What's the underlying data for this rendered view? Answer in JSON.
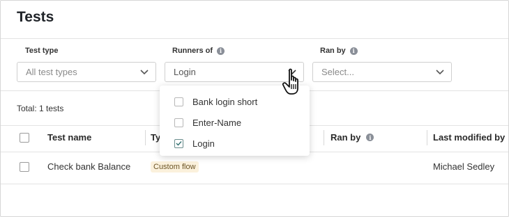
{
  "page": {
    "title": "Tests"
  },
  "filters": {
    "test_type": {
      "label": "Test type",
      "placeholder": "All test types"
    },
    "runners_of": {
      "label": "Runners of",
      "value": "Login"
    },
    "ran_by": {
      "label": "Ran by",
      "placeholder": "Select..."
    }
  },
  "dropdown": {
    "options": [
      {
        "label": "Bank login short",
        "checked": false
      },
      {
        "label": "Enter-Name",
        "checked": false
      },
      {
        "label": "Login",
        "checked": true
      }
    ]
  },
  "summary": {
    "total": "Total: 1 tests"
  },
  "table": {
    "columns": [
      "Test name",
      "Ty",
      "Ran by",
      "Last modified by"
    ],
    "rows": [
      {
        "name": "Check bank Balance",
        "type": "Custom flow",
        "ran_by": "",
        "last_modified_by": "Michael Sedley"
      }
    ]
  },
  "colors": {
    "badge_bg": "#fbf1dc",
    "badge_text": "#6b5426",
    "check_accent": "#2f6f6f"
  },
  "icons": [
    "info-icon",
    "chevron-down-icon",
    "check-icon",
    "hand-cursor-icon"
  ]
}
